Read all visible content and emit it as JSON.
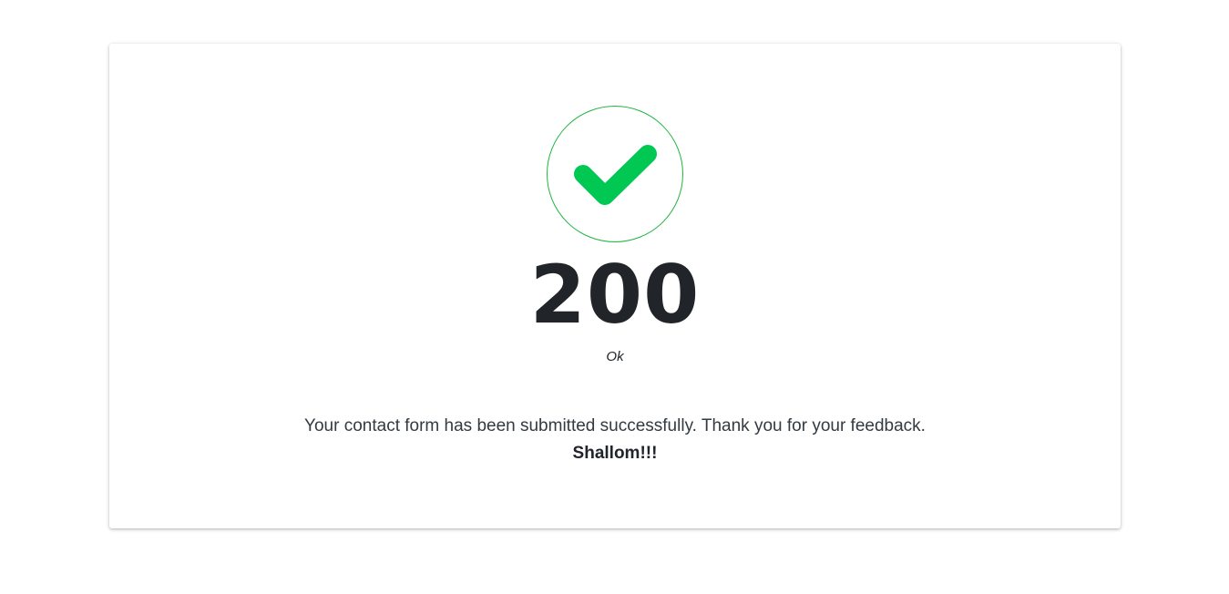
{
  "result": {
    "icon": "check-icon",
    "accent_color": "#00c853",
    "status_code": "200",
    "status_text": "Ok",
    "message": "Your contact form has been submitted successfully. Thank you for your feedback.",
    "signoff": "Shallom!!!"
  }
}
